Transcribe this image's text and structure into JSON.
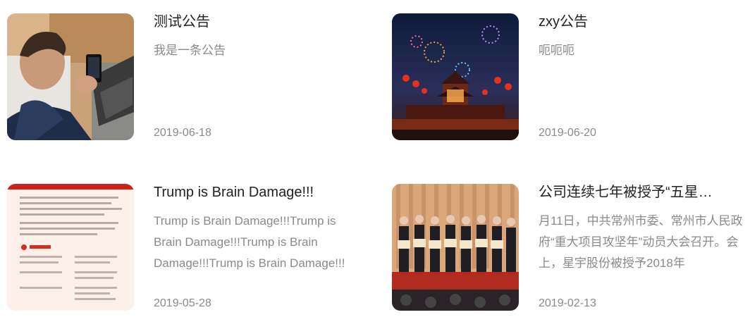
{
  "notices": [
    {
      "title": "测试公告",
      "desc": "我是一条公告",
      "date": "2019-06-18",
      "image": "person-using-phone-laptop"
    },
    {
      "title": "zxy公告",
      "desc": "呃呃呃",
      "date": "2019-06-20",
      "image": "night-festival-fireworks"
    },
    {
      "title": "Trump is Brain Damage!!!",
      "desc": "Trump is Brain Damage!!!Trump is Brain Damage!!!Trump is Brain Damage!!!Trump is Brain Damage!!!",
      "date": "2019-05-28",
      "image": "document-page"
    },
    {
      "title": "公司连续七年被授予“五星…",
      "desc": "月11日，中共常州市委、常州市人民政府“重大项目攻坚年”动员大会召开。会上，星宇股份被授予2018年",
      "date": "2019-02-13",
      "image": "award-ceremony"
    }
  ]
}
